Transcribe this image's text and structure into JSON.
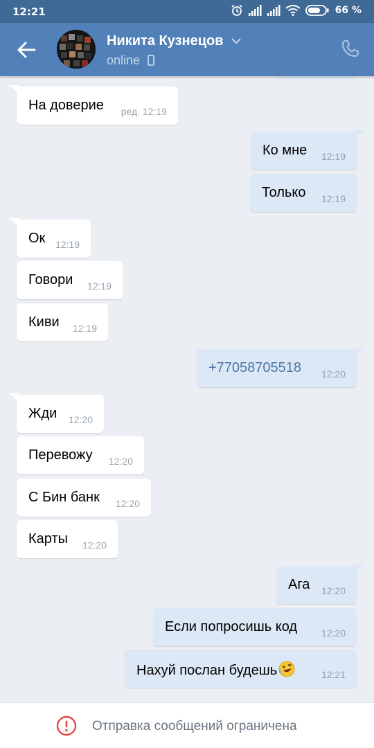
{
  "statusbar": {
    "time": "12:21",
    "battery": "66 %"
  },
  "header": {
    "name": "Никита Кузнецов",
    "status": "online"
  },
  "messages": [
    {
      "dir": "in",
      "text": "На доверие",
      "time": "ред. 12:19"
    },
    {
      "dir": "out",
      "text": "Ко мне",
      "time": "12:19"
    },
    {
      "dir": "out",
      "text": "Только",
      "time": "12:19"
    },
    {
      "dir": "in",
      "text": "Ок",
      "time": "12:19"
    },
    {
      "dir": "in",
      "text": "Говори",
      "time": "12:19"
    },
    {
      "dir": "in",
      "text": "Киви",
      "time": "12:19"
    },
    {
      "dir": "out",
      "text": "+77058705518",
      "time": "12:20"
    },
    {
      "dir": "in",
      "text": "Жди",
      "time": "12:20"
    },
    {
      "dir": "in",
      "text": "Перевожу",
      "time": "12:20"
    },
    {
      "dir": "in",
      "text": "С Бин банк",
      "time": "12:20"
    },
    {
      "dir": "in",
      "text": "Карты",
      "time": "12:20"
    },
    {
      "dir": "out",
      "text": "Ага",
      "time": "12:20"
    },
    {
      "dir": "out",
      "text": "Если попросишь код",
      "time": "12:20"
    },
    {
      "dir": "out",
      "text": "Нахуй послан будешь",
      "time": "12:21"
    }
  ],
  "bottom": {
    "notice": "Отправка сообщений ограничена"
  },
  "colors": {
    "header": "#5181b8",
    "statusbar": "#3f6a96",
    "background": "#ebeef2",
    "outgoing": "#dde8f6",
    "incoming": "#ffffff"
  },
  "icons": [
    "back-arrow-icon",
    "chevron-down-icon",
    "phone-icon",
    "mobile-device-icon",
    "alarm-icon",
    "signal-icon",
    "wifi-icon",
    "battery-icon",
    "warning-icon",
    "rofl-emoji-icon"
  ]
}
